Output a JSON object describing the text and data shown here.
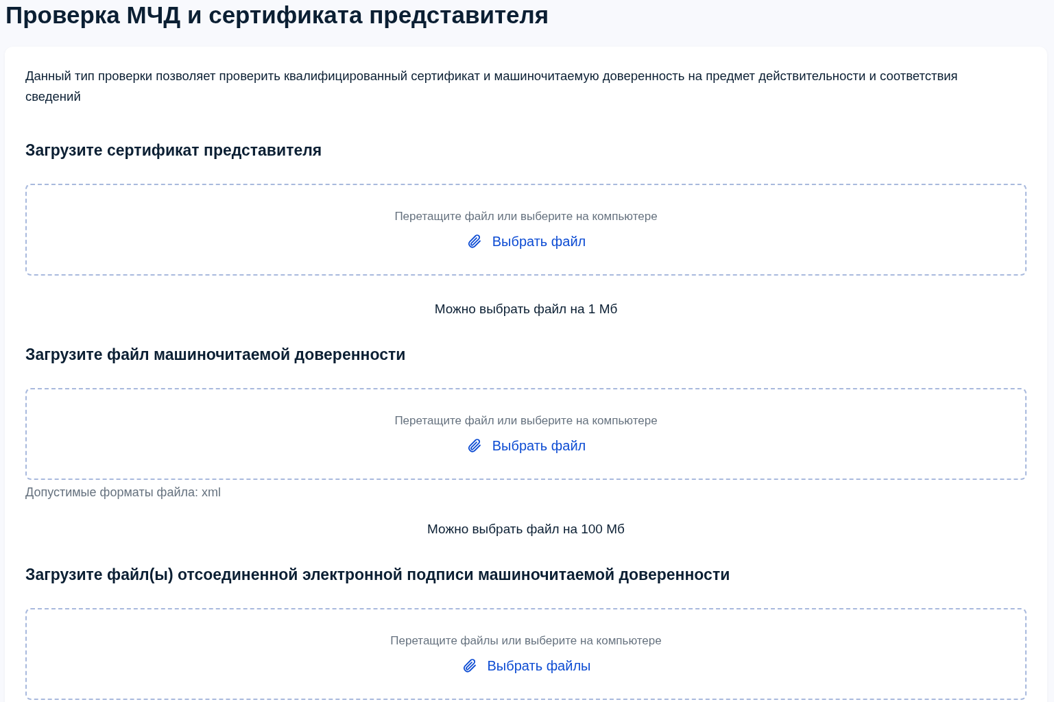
{
  "page": {
    "title": "Проверка МЧД и сертификата представителя"
  },
  "card": {
    "description": "Данный тип проверки позволяет проверить квалифицированный сертификат и машиночитаемую доверенность на предмет действительности и соответствия сведений",
    "sections": [
      {
        "heading": "Загрузите сертификат представителя",
        "dropzone": {
          "hint": "Перетащите файл или выберите на компьютере",
          "button": "Выбрать файл"
        },
        "limit": "Можно выбрать файл на 1 Мб"
      },
      {
        "heading": "Загрузите файл машиночитаемой доверенности",
        "dropzone": {
          "hint": "Перетащите файл или выберите на компьютере",
          "button": "Выбрать файл"
        },
        "formats": "Допустимые форматы файла: xml",
        "limit": "Можно выбрать файл на 100 Мб"
      },
      {
        "heading": "Загрузите файл(ы) отсоединенной электронной подписи машиночитаемой доверенности",
        "dropzone": {
          "hint": "Перетащите файлы или выберите на компьютере",
          "button": "Выбрать файлы"
        }
      }
    ]
  }
}
